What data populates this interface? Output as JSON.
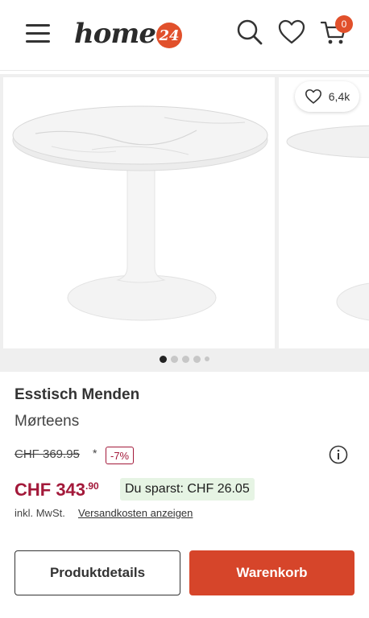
{
  "header": {
    "logo_text": "home",
    "logo_badge": "24",
    "cart_count": "0"
  },
  "gallery": {
    "wishlist_count": "6,4k",
    "slide_count": 5,
    "active_slide": 1
  },
  "product": {
    "title": "Esstisch Menden",
    "brand": "Mørteens",
    "old_price": "CHF 369.95",
    "asterisk": "*",
    "discount": "-7%",
    "price_main": "CHF 343",
    "price_cents": ".90",
    "savings": "Du sparst: CHF 26.05",
    "vat": "inkl. MwSt.",
    "shipping_link": "Versandkosten anzeigen"
  },
  "actions": {
    "details_label": "Produktdetails",
    "cart_label": "Warenkorb"
  },
  "colors": {
    "accent": "#e1502b",
    "cart_button": "#d6452a",
    "price": "#a3193a",
    "savings_bg": "#e6f4e4"
  },
  "icons": [
    "menu-icon",
    "search-icon",
    "heart-icon",
    "cart-icon",
    "info-icon"
  ]
}
